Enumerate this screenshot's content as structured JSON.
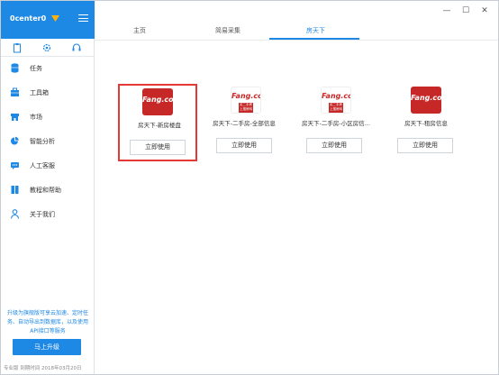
{
  "sidebar": {
    "username": "0center0",
    "menu": [
      {
        "label": "任务",
        "icon": "database-icon"
      },
      {
        "label": "工具箱",
        "icon": "toolbox-icon"
      },
      {
        "label": "市场",
        "icon": "store-icon"
      },
      {
        "label": "智能分析",
        "icon": "pie-chart-icon"
      },
      {
        "label": "人工客服",
        "icon": "chat-icon"
      },
      {
        "label": "教程和帮助",
        "icon": "book-icon"
      },
      {
        "label": "关于我们",
        "icon": "person-icon"
      }
    ],
    "promo": "升级为旗舰版可享云加速、定时任务、自动导出到数据库，以及使用API接口等服务",
    "upgrade_label": "马上升级",
    "footer": "专业版  到期时间 2018年03月20日"
  },
  "tabs": [
    {
      "label": "主页"
    },
    {
      "label": "简易采集"
    },
    {
      "label": "房天下"
    }
  ],
  "active_tab": "房天下",
  "cards": [
    {
      "name": "房天下-新房楼盘",
      "button": "立即使用",
      "logo_text": "Fang.com"
    },
    {
      "name": "房天下-二手房-全部信息",
      "button": "立即使用",
      "logo_text": "Fang.com",
      "logo_sub": "买二手房 上搜房网"
    },
    {
      "name": "房天下-二手房-小区房信...",
      "button": "立即使用",
      "logo_text": "Fang.com",
      "logo_sub": "买二手房 上搜房网"
    },
    {
      "name": "房天下-租房信息",
      "button": "立即使用",
      "logo_text": "Fang.com"
    }
  ],
  "colors": {
    "accent": "#1e88e5",
    "brand_red": "#c62828",
    "selection": "#e53935"
  }
}
